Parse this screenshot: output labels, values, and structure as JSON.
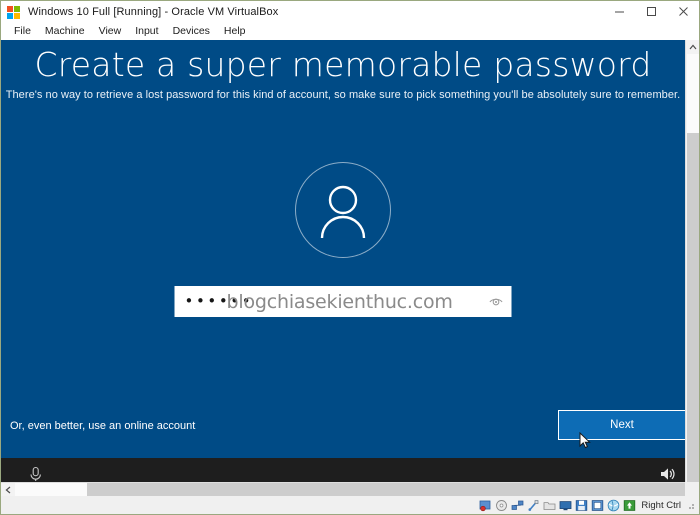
{
  "window": {
    "title": "Windows 10 Full [Running] - Oracle VM VirtualBox",
    "icon": "windows-logo-icon",
    "controls": {
      "minimize": "minimize-icon",
      "maximize": "maximize-icon",
      "close": "close-icon"
    }
  },
  "menubar": {
    "items": [
      {
        "label": "File"
      },
      {
        "label": "Machine"
      },
      {
        "label": "View"
      },
      {
        "label": "Input"
      },
      {
        "label": "Devices"
      },
      {
        "label": "Help"
      }
    ]
  },
  "oobe": {
    "heading": "Create a super memorable password",
    "subtitle": "There's no way to retrieve a lost password for this kind of account, so make sure to pick something you'll be absolutely sure to remember.",
    "avatar_icon": "user-avatar-icon",
    "password": {
      "value": "••••••",
      "watermark": "blogchiasekienthuc.com",
      "reveal_icon": "eye-reveal-icon"
    },
    "online_account_link": "Or, even better, use an online account",
    "next_button": "Next",
    "colors": {
      "background": "#004b86",
      "accent": "#0d6cb5",
      "field_background": "#ffffff",
      "watermark_text": "#8a8a8a"
    }
  },
  "taskbar": {
    "left_icon": "ease-of-access-microphone-icon",
    "right_icon": "volume-speaker-icon",
    "background": "#1e1e1e"
  },
  "statusbar": {
    "icons": [
      "hard-disk-icon",
      "optical-disk-icon",
      "network-icon",
      "usb-icon",
      "shared-folder-icon",
      "display-icon",
      "recording-icon",
      "mouse-integration-icon",
      "keyboard-icon",
      "host-key-icon"
    ],
    "host_key_label": "Right Ctrl"
  },
  "scrollbars": {
    "vertical_up_arrow": "chevron-up-icon",
    "horizontal_left_arrow": "chevron-left-icon"
  }
}
